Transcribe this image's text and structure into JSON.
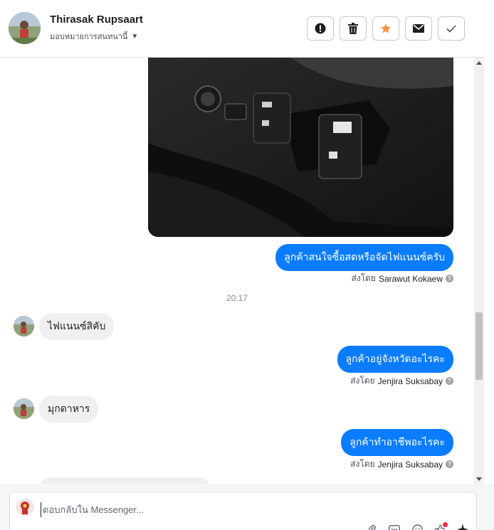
{
  "header": {
    "name": "Thirasak Rupsaart",
    "assign_label": "มอบหมายการสนทนานี้",
    "actions": [
      "mark-spam",
      "delete",
      "star",
      "mark-unread",
      "mark-done"
    ]
  },
  "messages": {
    "out1": "ลูกค้าสนใจซื้อสดหรือจัดไฟแนนซ์ครับ",
    "out1_sent_by_prefix": "ส่งโดย",
    "out1_sender": "Sarawut Kokaew",
    "time": "20:17",
    "in1": "ไฟแนนซ์สิคับ",
    "out2": "ลูกค้าอยู่จังหวัดอะไรคะ",
    "out2_sent_by_prefix": "ส่งโดย",
    "out2_sender": "Jenjira Suksabay",
    "in2": "มุกดาหาร",
    "out3": "ลูกค้าทำอาชีพอะไรคะ",
    "out3_sent_by_prefix": "ส่งโดย",
    "out3_sender": "Jenjira Suksabay"
  },
  "composer": {
    "placeholder": "ตอบกลับใน Messenger..."
  },
  "colors": {
    "accent": "#0a7cff",
    "star": "#f7923b",
    "incoming_bubble": "#f0f0f0"
  }
}
